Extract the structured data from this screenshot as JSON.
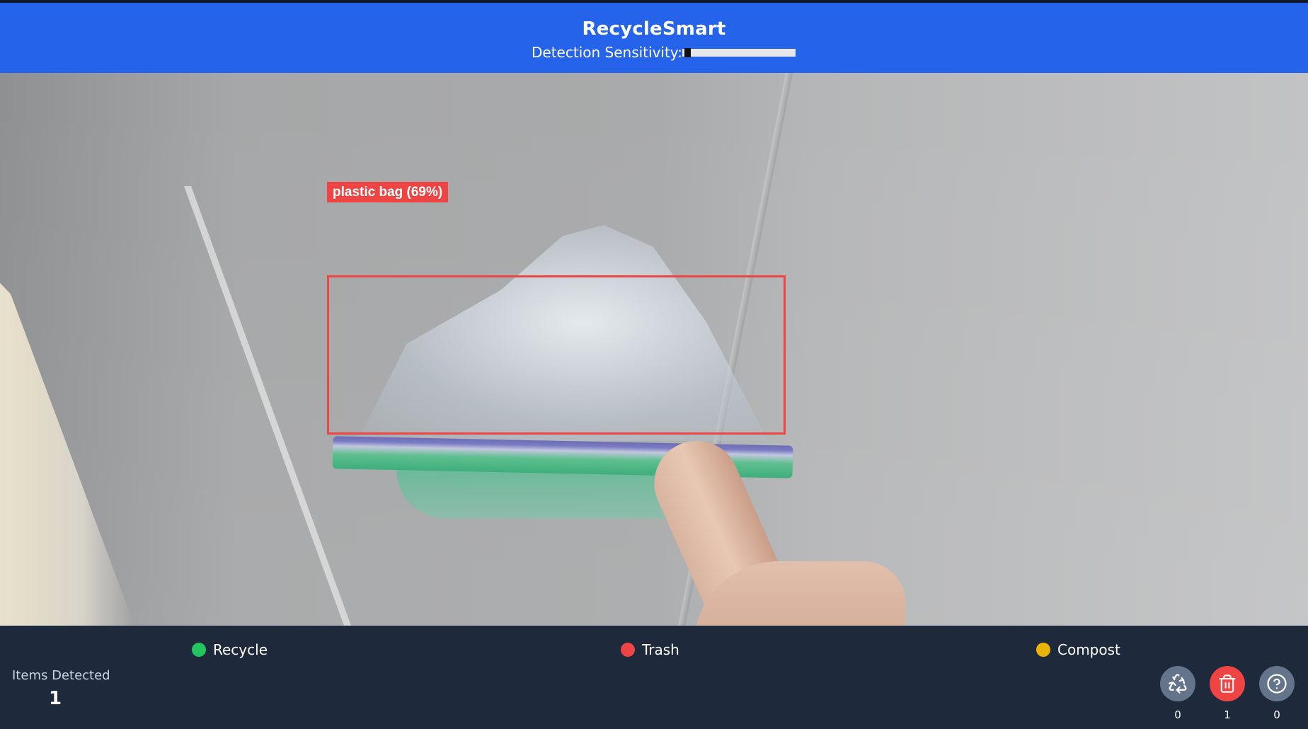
{
  "header": {
    "title": "RecycleSmart",
    "sensitivity_label": "Detection Sensitivity:",
    "sensitivity_value": 0.02
  },
  "detection": {
    "label": "plastic bag (69%)",
    "color": "#ef4444"
  },
  "legend": [
    {
      "label": "Recycle",
      "color": "#22c55e"
    },
    {
      "label": "Trash",
      "color": "#ef4444"
    },
    {
      "label": "Compost",
      "color": "#eab308"
    }
  ],
  "stats": {
    "items_detected_label": "Items Detected",
    "items_detected_count": "1"
  },
  "bins": [
    {
      "name": "recycle",
      "icon": "recycle-icon",
      "count": "0",
      "color": "#64748b"
    },
    {
      "name": "trash",
      "icon": "trash-icon",
      "count": "1",
      "color": "#ef4444"
    },
    {
      "name": "unknown",
      "icon": "question-icon",
      "count": "0",
      "color": "#64748b"
    }
  ],
  "colors": {
    "header_bg": "#2563eb",
    "footer_bg": "#1e293b"
  }
}
